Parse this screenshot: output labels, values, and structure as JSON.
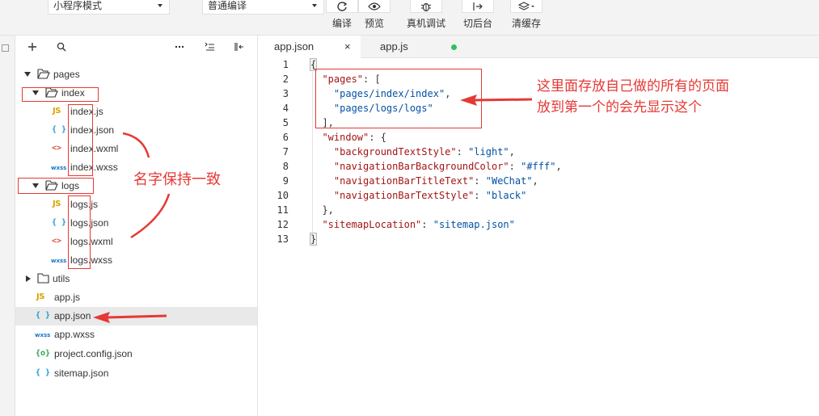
{
  "toolbar": {
    "mode_select": "小程序模式",
    "compile_select": "普通编译",
    "buttons": {
      "compile": "编译",
      "preview": "预览",
      "remote_debug": "真机调试",
      "background": "切后台",
      "clear_cache": "清缓存"
    }
  },
  "explorer": {
    "tree": {
      "pages": "pages",
      "index": "index",
      "index_js": "index.js",
      "index_json": "index.json",
      "index_wxml": "index.wxml",
      "index_wxss": "index.wxss",
      "logs": "logs",
      "logs_js": "logs.js",
      "logs_json": "logs.json",
      "logs_wxml": "logs.wxml",
      "logs_wxss": "logs.wxss",
      "utils": "utils",
      "app_js": "app.js",
      "app_json": "app.json",
      "app_wxss": "app.wxss",
      "project_config": "project.config.json",
      "sitemap": "sitemap.json"
    },
    "icons": {
      "js": "JS",
      "json": "{ }",
      "wxml": "<>",
      "wxss": "wxss",
      "config": "{o}"
    },
    "selected": "app.json"
  },
  "editor": {
    "tabs": [
      {
        "label": "app.json",
        "close": "×"
      },
      {
        "label": "app.js"
      }
    ],
    "line_numbers": [
      "1",
      "2",
      "3",
      "4",
      "5",
      "6",
      "7",
      "8",
      "9",
      "10",
      "11",
      "12",
      "13"
    ],
    "code": {
      "l1": "{",
      "pages_key": "\"pages\"",
      "pages_open": ": [",
      "page1": "\"pages/index/index\"",
      "page2": "\"pages/logs/logs\"",
      "pages_close": "],",
      "window_key": "\"window\"",
      "window_open": ": {",
      "bts_key": "\"backgroundTextStyle\"",
      "bts_val": "\"light\"",
      "nbbc_key": "\"navigationBarBackgroundColor\"",
      "nbbc_val": "\"#fff\"",
      "nbtt_key": "\"navigationBarTitleText\"",
      "nbtt_val": "\"WeChat\"",
      "nbts_key": "\"navigationBarTextStyle\"",
      "nbts_val": "\"black\"",
      "window_close": "},",
      "sitemap_key": "\"sitemapLocation\"",
      "sitemap_val": "\"sitemap.json\"",
      "l13": "}"
    }
  },
  "annotations": {
    "pages_note_line1": "这里面存放自己做的所有的页面",
    "pages_note_line2": "放到第一个的会先显示这个",
    "name_note": "名字保持一致"
  },
  "colors": {
    "annotation": "#e53935",
    "json_key": "#a31515",
    "json_string": "#0451a5",
    "modified_dot": "#2bc25c"
  }
}
